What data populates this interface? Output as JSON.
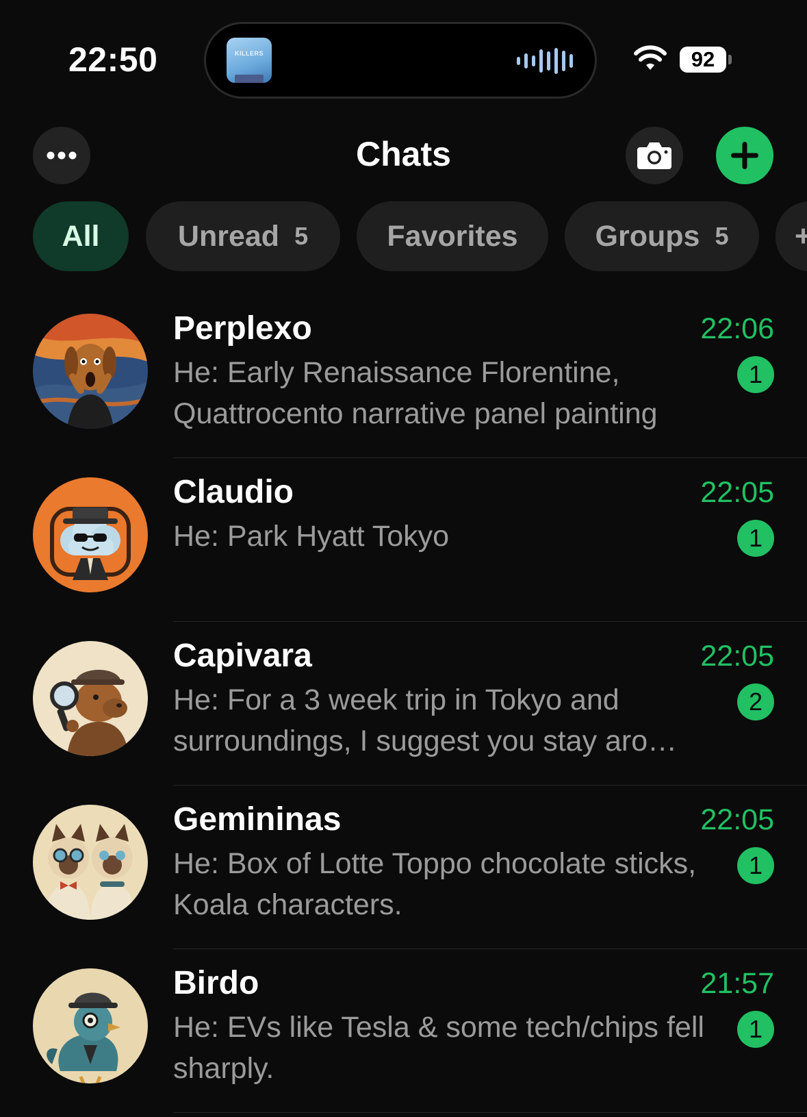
{
  "status_bar": {
    "time": "22:50",
    "battery": "92",
    "now_playing_art_text": "KILLERS"
  },
  "header": {
    "title": "Chats"
  },
  "filters": [
    {
      "label": "All",
      "count": ""
    },
    {
      "label": "Unread",
      "count": "5"
    },
    {
      "label": "Favorites",
      "count": ""
    },
    {
      "label": "Groups",
      "count": "5"
    },
    {
      "label": "+",
      "count": ""
    }
  ],
  "chats": [
    {
      "name": "Perplexo",
      "time": "22:06",
      "preview": "He: Early Renaissance Florentine, Quattrocento narrative panel painting",
      "unread": "1",
      "avatar": "dog-scream-avatar"
    },
    {
      "name": "Claudio",
      "time": "22:05",
      "preview": "He: Park Hyatt Tokyo",
      "unread": "1",
      "avatar": "cloud-detective-avatar"
    },
    {
      "name": "Capivara",
      "time": "22:05",
      "preview": "He: For a 3 week trip in Tokyo and surroundings, I suggest you stay aro…",
      "unread": "2",
      "avatar": "capybara-detective-avatar"
    },
    {
      "name": "Gemininas",
      "time": "22:05",
      "preview": "He: Box of Lotte Toppo chocolate sticks, Koala characters.",
      "unread": "1",
      "avatar": "twin-cats-avatar"
    },
    {
      "name": "Birdo",
      "time": "21:57",
      "preview": "He: EVs like Tesla & some tech/chips fell sharply.",
      "unread": "1",
      "avatar": "bird-detective-avatar"
    }
  ],
  "colors": {
    "background": "#0b0b0b",
    "accent_green": "#21c063",
    "chip_background": "#1f1f1f",
    "active_chip_background": "#103a2a"
  }
}
